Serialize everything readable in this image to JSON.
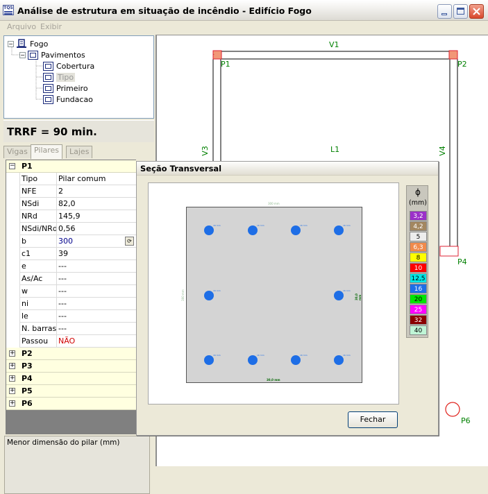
{
  "window": {
    "title": "Análise de estrutura em situação de incêndio - Edifício Fogo",
    "icon_text": "TQS"
  },
  "menu": {
    "items": [
      "Arquivo",
      "Exibir"
    ]
  },
  "tree": {
    "root": "Fogo",
    "pavimentos": "Pavimentos",
    "floors": [
      "Cobertura",
      "Tipo",
      "Primeiro",
      "Fundacao"
    ],
    "selected": "Tipo"
  },
  "trrf": "TRRF = 90 min.",
  "tabs": [
    "Vigas",
    "Pilares",
    "Lajes"
  ],
  "active_tab": "Pilares",
  "pillar": {
    "name": "P1",
    "properties": [
      {
        "key": "Tipo",
        "value": "Pilar comum"
      },
      {
        "key": "NFE",
        "value": "2"
      },
      {
        "key": "NSdi",
        "value": "82,0"
      },
      {
        "key": "NRd",
        "value": "145,9"
      },
      {
        "key": "NSdi/NRd",
        "value": "0,56"
      },
      {
        "key": "b",
        "value": "300"
      },
      {
        "key": "c1",
        "value": "39"
      },
      {
        "key": "e",
        "value": "---"
      },
      {
        "key": "As/Ac",
        "value": "---"
      },
      {
        "key": "w",
        "value": "---"
      },
      {
        "key": "ni",
        "value": "---"
      },
      {
        "key": "le",
        "value": "---"
      },
      {
        "key": "N. barras",
        "value": "---"
      },
      {
        "key": "Passou",
        "value": "NÃO"
      }
    ]
  },
  "other_pillars": [
    "P2",
    "P3",
    "P4",
    "P5",
    "P6"
  ],
  "status": "Menor dimensão do pilar (mm)",
  "drawing": {
    "labels": {
      "v1": "V1",
      "v3": "V3",
      "v4": "V4",
      "l1": "L1",
      "p1": "P1",
      "p2": "P2",
      "p4": "P4",
      "p6": "P6"
    }
  },
  "dialog": {
    "title": "Seção Transversal",
    "close_label": "Fechar",
    "dim_top": "300 mm",
    "dim_bottom": "30,0 mm",
    "dim_left": "300 mm",
    "dim_right": "30,0 mm",
    "bar_label": "16 mm",
    "legend": {
      "symbol": "ϕ",
      "unit": "(mm)",
      "items": [
        {
          "label": "3,2",
          "color": "#9B30C9"
        },
        {
          "label": "4,2",
          "color": "#A38760"
        },
        {
          "label": "5",
          "color": "#EDEDED"
        },
        {
          "label": "6,3",
          "color": "#F08A4B"
        },
        {
          "label": "8",
          "color": "#FFFF00"
        },
        {
          "label": "10",
          "color": "#FF0000"
        },
        {
          "label": "12,5",
          "color": "#00E5E5"
        },
        {
          "label": "16",
          "color": "#1E6EE6"
        },
        {
          "label": "20",
          "color": "#00E600"
        },
        {
          "label": "25",
          "color": "#FF00FF"
        },
        {
          "label": "32",
          "color": "#8B0000"
        },
        {
          "label": "40",
          "color": "#BFF5D6"
        }
      ]
    }
  }
}
